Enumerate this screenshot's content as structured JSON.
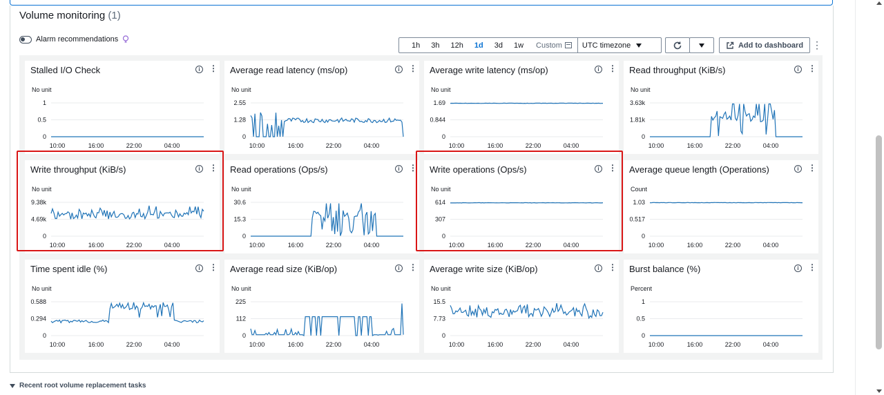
{
  "section": {
    "title": "Volume monitoring",
    "count": "(1)"
  },
  "alarm": {
    "label": "Alarm recommendations"
  },
  "time_ranges": [
    {
      "label": "1h",
      "active": false
    },
    {
      "label": "3h",
      "active": false
    },
    {
      "label": "12h",
      "active": false
    },
    {
      "label": "1d",
      "active": true
    },
    {
      "label": "3d",
      "active": false
    },
    {
      "label": "1w",
      "active": false
    }
  ],
  "custom_label": "Custom",
  "timezone": "UTC timezone",
  "add_dashboard": "Add to dashboard",
  "footer": {
    "label": "Recent root volume replacement tasks"
  },
  "colors": {
    "line": "#1f73b7",
    "highlight": "#d91515",
    "active": "#0972d3"
  },
  "x_ticks": [
    "10:00",
    "16:00",
    "22:00",
    "04:00"
  ],
  "charts": [
    {
      "title": "Stalled I/O Check",
      "unit": "No unit",
      "y_ticks": [
        "1",
        "0.5",
        "0"
      ],
      "ymax": 1,
      "pattern": "flat0",
      "level": 0,
      "highlight": false
    },
    {
      "title": "Average read latency (ms/op)",
      "unit": "No unit",
      "y_ticks": [
        "2.55",
        "1.28",
        "0"
      ],
      "ymax": 2.55,
      "pattern": "readlat",
      "level": 1.2,
      "highlight": false
    },
    {
      "title": "Average write latency (ms/op)",
      "unit": "No unit",
      "y_ticks": [
        "1.69",
        "0.844",
        "0"
      ],
      "ymax": 1.69,
      "pattern": "flat",
      "level": 1.67,
      "highlight": false
    },
    {
      "title": "Read throughput (KiB/s)",
      "unit": "No unit",
      "y_ticks": [
        "3.63k",
        "1.81k",
        "0"
      ],
      "ymax": 3630,
      "pattern": "burst",
      "level": 2600,
      "highlight": false
    },
    {
      "title": "Write throughput (KiB/s)",
      "unit": "No unit",
      "y_ticks": [
        "9.38k",
        "4.69k",
        "0"
      ],
      "ymax": 9380,
      "pattern": "noisy",
      "level": 5800,
      "highlight": true
    },
    {
      "title": "Read operations (Ops/s)",
      "unit": "No unit",
      "y_ticks": [
        "30.6",
        "15.3",
        "0"
      ],
      "ymax": 30.6,
      "pattern": "burst",
      "level": 22,
      "highlight": false
    },
    {
      "title": "Write operations (Ops/s)",
      "unit": "No unit",
      "y_ticks": [
        "614",
        "307",
        "0"
      ],
      "ymax": 614,
      "pattern": "flat",
      "level": 605,
      "highlight": true
    },
    {
      "title": "Average queue length (Operations)",
      "unit": "Count",
      "y_ticks": [
        "1.03",
        "0.517",
        "0"
      ],
      "ymax": 1.03,
      "pattern": "flat",
      "level": 1.02,
      "highlight": false
    },
    {
      "title": "Time spent idle (%)",
      "unit": "No unit",
      "y_ticks": [
        "0.588",
        "0.294",
        "0"
      ],
      "ymax": 0.588,
      "pattern": "idle",
      "level": 0.4,
      "highlight": false
    },
    {
      "title": "Average read size (KiB/op)",
      "unit": "No unit",
      "y_ticks": [
        "225",
        "112",
        "0"
      ],
      "ymax": 225,
      "pattern": "readsize",
      "level": 120,
      "highlight": false
    },
    {
      "title": "Average write size (KiB/op)",
      "unit": "No unit",
      "y_ticks": [
        "15.5",
        "7.73",
        "0"
      ],
      "ymax": 15.5,
      "pattern": "noisy",
      "level": 10,
      "highlight": false
    },
    {
      "title": "Burst balance (%)",
      "unit": "Percent",
      "y_ticks": [
        "1",
        "0.5",
        "0"
      ],
      "ymax": 1,
      "pattern": "flat0",
      "level": 0,
      "highlight": false
    }
  ]
}
